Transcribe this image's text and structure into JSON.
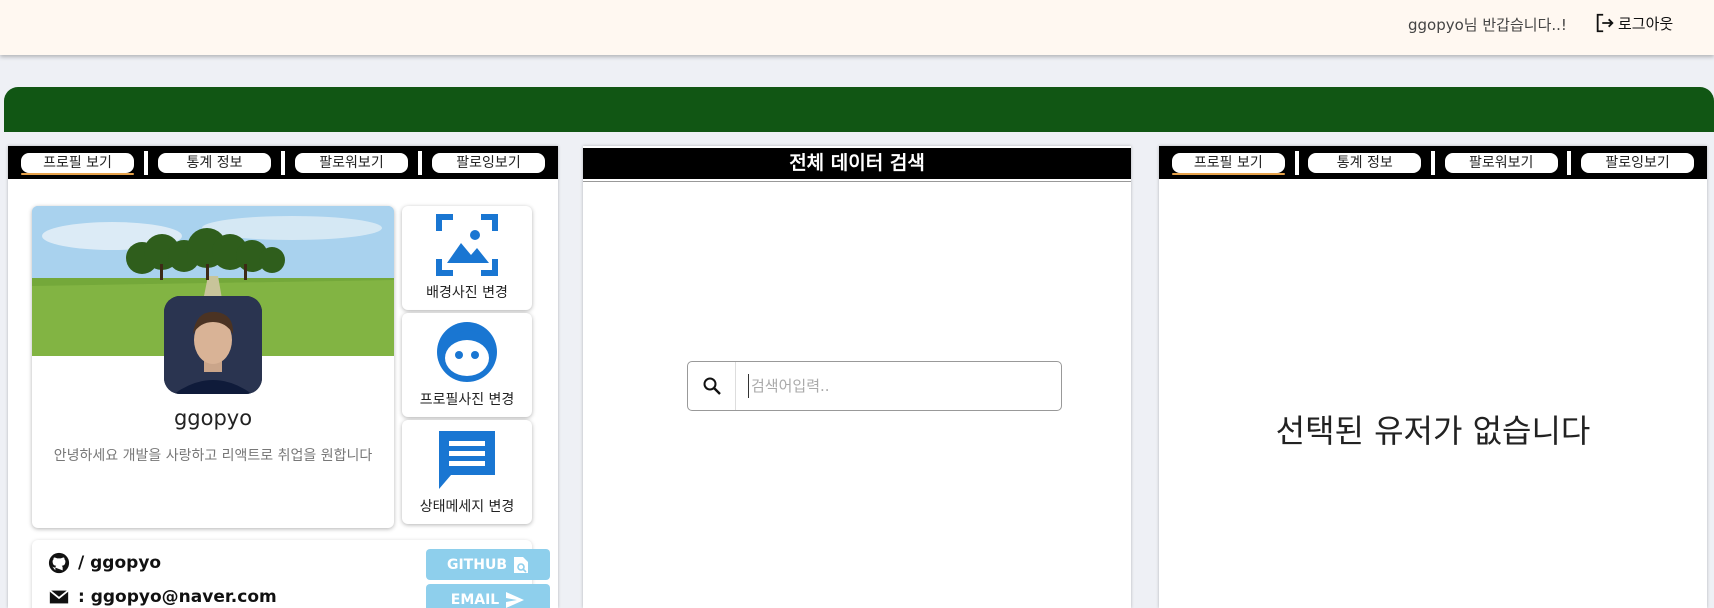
{
  "header": {
    "greeting": "ggopyo님 반갑습니다..!",
    "logout_label": "로그아웃"
  },
  "left_panel": {
    "tabs": [
      "프로필 보기",
      "통계 정보",
      "팔로워보기",
      "팔로잉보기"
    ],
    "profile": {
      "username": "ggopyo",
      "status_message": "안녕하세요 개발을 사랑하고 리액트로 취업을 원합니다"
    },
    "actions": {
      "change_background": "배경사진 변경",
      "change_profile_photo": "프로필사진 변경",
      "change_status": "상태메세지 변경"
    },
    "links": {
      "github_text": "/ ggopyo",
      "email_text": ": ggopyo@naver.com",
      "github_button": "GITHUB",
      "email_button": "EMAIL"
    }
  },
  "middle_panel": {
    "title": "전체 데이터 검색",
    "search_placeholder": "검색어입력.."
  },
  "right_panel": {
    "tabs": [
      "프로필 보기",
      "통계 정보",
      "팔로워보기",
      "팔로잉보기"
    ],
    "empty_message": "선택된 유저가 없습니다"
  },
  "colors": {
    "appbar_bg": "#fff8f1",
    "banner_green": "#115614",
    "icon_blue": "#1976d2",
    "link_button_blue": "#8ecfec",
    "tab_active_underline": "#e6a24b"
  },
  "icons": [
    "logout-icon",
    "image-icon",
    "face-icon",
    "message-icon",
    "github-icon",
    "mail-icon",
    "search-icon",
    "send-icon",
    "file-search-icon"
  ]
}
